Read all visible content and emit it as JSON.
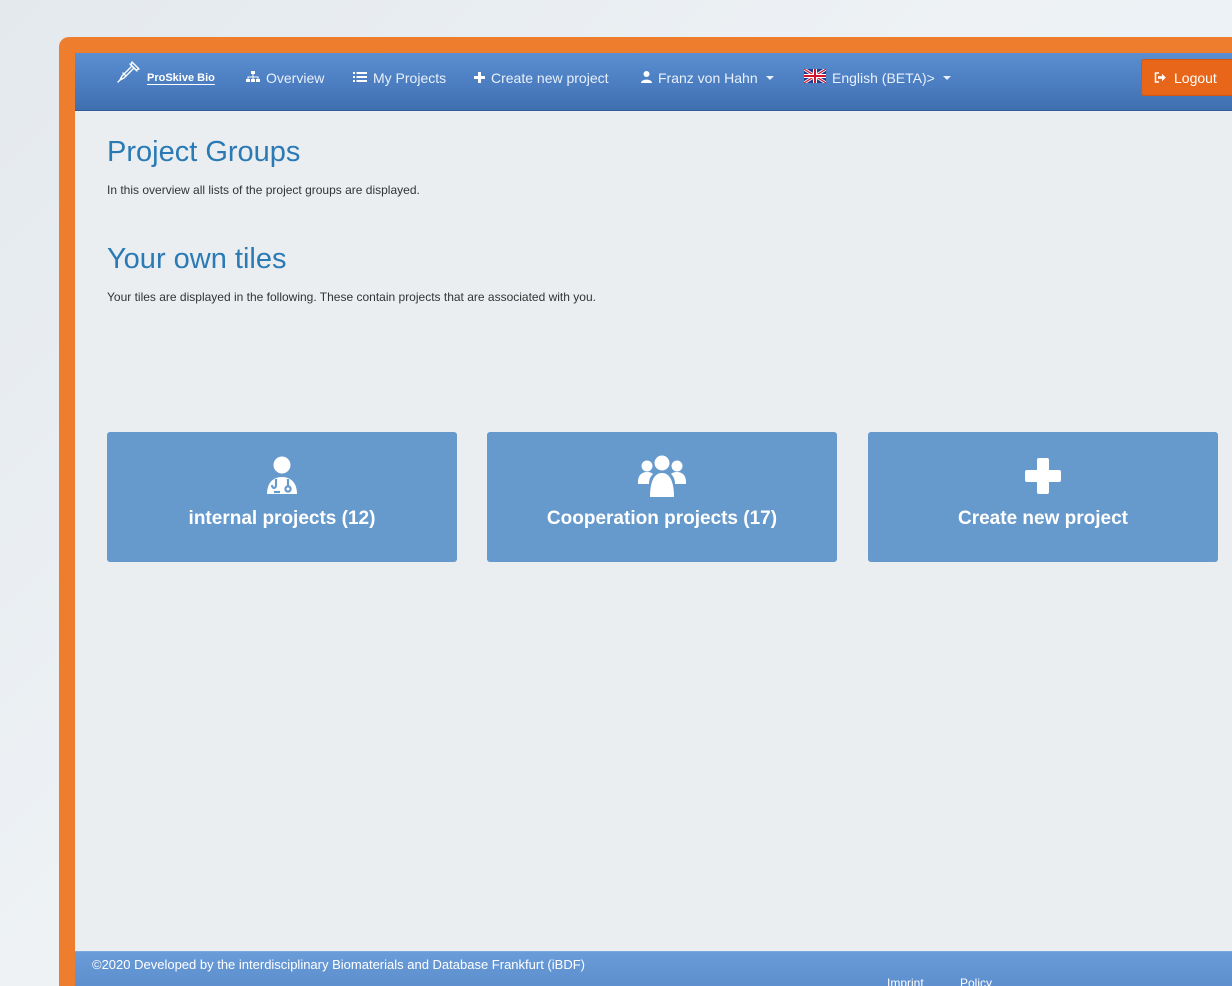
{
  "navbar": {
    "brand": "ProSkive Bio",
    "overview": "Overview",
    "my_projects": "My Projects",
    "create_new_project": "Create new project",
    "user": "Franz von Hahn",
    "language": "English (BETA)>",
    "logout": "Logout"
  },
  "main": {
    "title": "Project Groups",
    "description": "In this overview all lists of the project groups are displayed.",
    "tiles_title": "Your own tiles",
    "tiles_description": "Your tiles are displayed in the following. These contain projects that are associated with you."
  },
  "tiles": [
    {
      "label": "internal projects (12)",
      "icon": "doctor-icon"
    },
    {
      "label": "Cooperation projects (17)",
      "icon": "users-icon"
    },
    {
      "label": "Create new project",
      "icon": "plus-icon"
    }
  ],
  "footer": {
    "copyright": "©2020 Developed by the interdisciplinary Biomaterials and Database Frankfurt (iBDF)",
    "imprint": "Imprint",
    "policy": "Policy"
  },
  "colors": {
    "frame": "#ee7d2e",
    "navbar": "#4a7cbf",
    "tile": "#6699cc",
    "heading": "#2a7ab5",
    "logout": "#e8661a"
  }
}
